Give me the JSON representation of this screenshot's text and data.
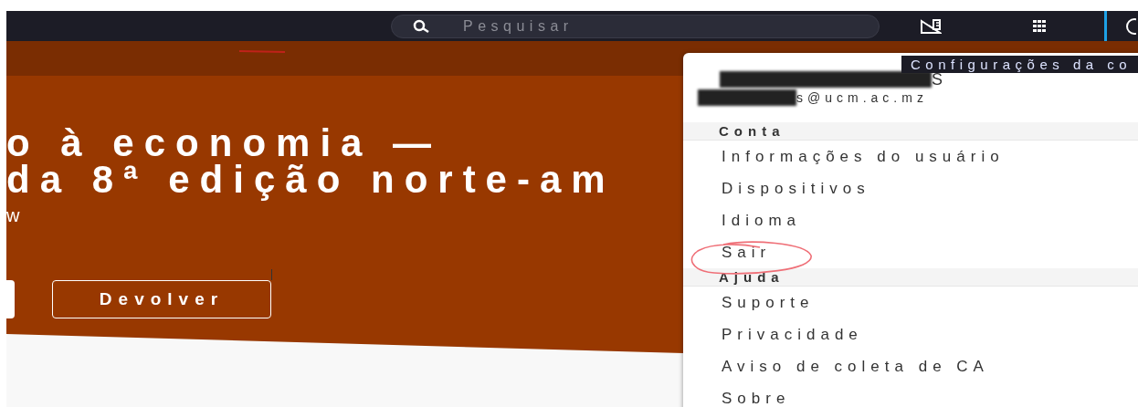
{
  "top_bar": {
    "search": {
      "placeholder": "Pesquisar"
    },
    "tooltip": "Configurações da co"
  },
  "hero": {
    "title_lines": [
      "o à economia —",
      "da 8ª edição norte-am"
    ],
    "subtitle": "w",
    "buttons": [
      {
        "kind": "filled"
      },
      {
        "kind": "outline",
        "label": "Devolver"
      }
    ]
  },
  "account_menu": {
    "user": {
      "name": "S",
      "email": "s@ucm.ac.mz"
    },
    "sections": [
      {
        "header": "Conta",
        "items": [
          {
            "label": "Informações do usuário",
            "circled": false
          },
          {
            "label": "Dispositivos",
            "circled": false
          },
          {
            "label": "Idioma",
            "circled": false
          },
          {
            "label": "Sair",
            "circled": true
          }
        ]
      },
      {
        "header": "Ajuda",
        "items": [
          {
            "label": "Suporte",
            "circled": false
          },
          {
            "label": "Privacidade",
            "circled": false
          },
          {
            "label": "Aviso de coleta de CA",
            "circled": false
          },
          {
            "label": "Sobre",
            "circled": false
          }
        ]
      }
    ]
  }
}
